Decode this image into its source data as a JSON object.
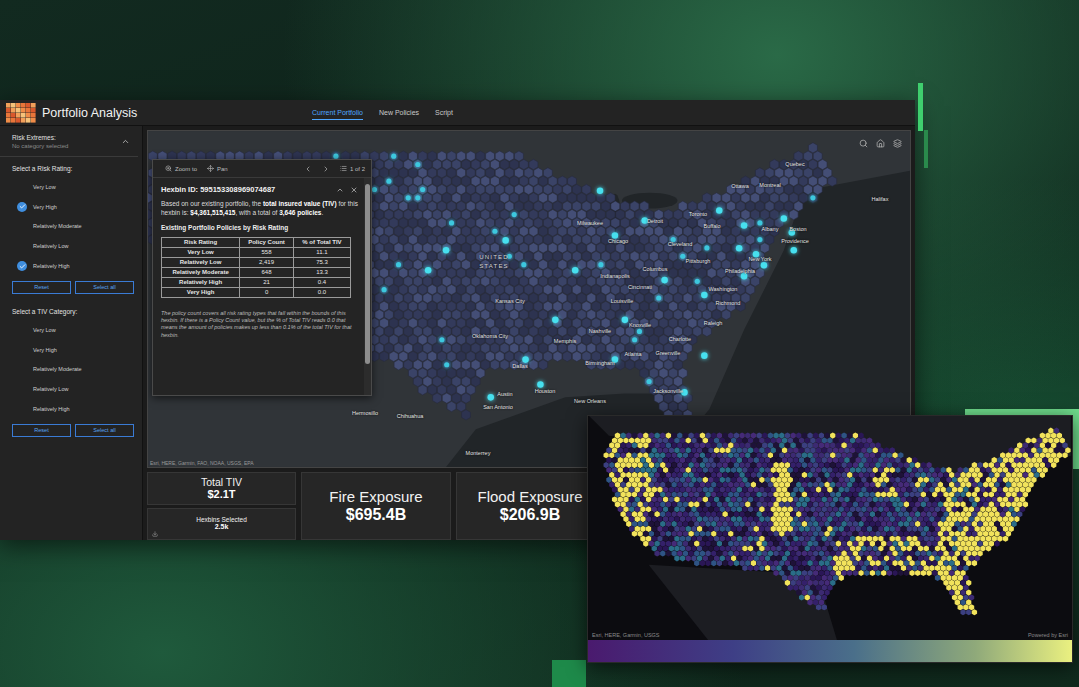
{
  "window": {
    "title": "Portfolio Analysis"
  },
  "tabs": [
    {
      "label": "Current Portfolio",
      "selected": true
    },
    {
      "label": "New Policies",
      "selected": false
    },
    {
      "label": "Script",
      "selected": false
    }
  ],
  "sidebar": {
    "risk_extremes": {
      "title": "Risk Extremes:",
      "value": "No category selected",
      "expanded": true
    },
    "risk_rating": {
      "title": "Select a Risk Rating:",
      "options": [
        {
          "label": "Very Low",
          "checked": false
        },
        {
          "label": "Very High",
          "checked": true
        },
        {
          "label": "Relatively Moderate",
          "checked": false
        },
        {
          "label": "Relatively Low",
          "checked": false
        },
        {
          "label": "Relatively High",
          "checked": true
        }
      ],
      "buttons": [
        "Reset",
        "Select all"
      ]
    },
    "tiv_category": {
      "title": "Select a TIV Category:",
      "options": [
        {
          "label": "Very Low",
          "checked": false
        },
        {
          "label": "Very High",
          "checked": false
        },
        {
          "label": "Relatively Moderate",
          "checked": false
        },
        {
          "label": "Relatively Low",
          "checked": false
        },
        {
          "label": "Relatively High",
          "checked": false
        }
      ],
      "buttons": [
        "Reset",
        "Select all"
      ]
    }
  },
  "map": {
    "country_label": "UNITED STATES",
    "labels": [
      "Quebec",
      "Ottawa",
      "Montreal",
      "Halifax",
      "Toronto",
      "Buffalo",
      "Albany",
      "Boston",
      "Providence",
      "New York",
      "Philadelphia",
      "Detroit",
      "Milwaukee",
      "Chicago",
      "Cleveland",
      "Pittsburgh",
      "Columbus",
      "Indianapolis",
      "Cincinnati",
      "Washington",
      "Richmond",
      "Louisville",
      "Nashville",
      "Knoxville",
      "Charlotte",
      "Raleigh",
      "Greenville",
      "Atlanta",
      "Birmingham",
      "Memphis",
      "Kansas City",
      "Oklahoma City",
      "Dallas",
      "Austin",
      "San Antonio",
      "Houston",
      "New Orleans",
      "Jacksonville",
      "Chihuahua",
      "Hermosillo",
      "Monterrey"
    ],
    "attribution": "Esri, HERE, Garmin, FAO, NOAA, USGS, EPA"
  },
  "popup": {
    "toolbar": {
      "zoom": "Zoom to",
      "pan": "Pan",
      "pager": "1 of 2"
    },
    "title": "Hexbin ID: 595153308969074687",
    "summary": [
      {
        "text": "Based on our existing portfolio, the ",
        "bold": false
      },
      {
        "text": "total insured value (TIV)",
        "bold": true
      },
      {
        "text": " for this hexbin is: ",
        "bold": false
      },
      {
        "text": "$4,361,515,415",
        "bold": true
      },
      {
        "text": ", with a total of ",
        "bold": false
      },
      {
        "text": "3,646 policies",
        "bold": true
      },
      {
        "text": ".",
        "bold": false
      }
    ],
    "table_title": "Existing Portfolio Policies by Risk Rating",
    "columns": [
      "Risk Rating",
      "Policy Count",
      "% of Total TIV"
    ],
    "rows": [
      [
        "Very Low",
        "558",
        "11.1"
      ],
      [
        "Relatively Low",
        "2,419",
        "75.3"
      ],
      [
        "Relatively Moderate",
        "648",
        "13.3"
      ],
      [
        "Relatively High",
        "21",
        "0.4"
      ],
      [
        "Very High",
        "0",
        "0.0"
      ]
    ],
    "note": "The policy count covers all risk rating types that fall within the bounds of this hexbin. If there is a Policy Count value, but the % of Total TIV reads 0.0 that means the amount of policies makes up less than 0.1% of the total TIV for that hexbin."
  },
  "cards": [
    {
      "label": "Total TIV",
      "value": "$2.1T"
    },
    {
      "label": "Hexbins Selected",
      "value": "2.5k"
    },
    {
      "label": "Fire Exposure",
      "value": "$695.4B"
    },
    {
      "label": "Flood Exposure",
      "value": "$206.9B"
    }
  ],
  "inset": {
    "attribution": "Esri, HERE, Garmin, USGS",
    "credit": "Powered by Esri"
  }
}
